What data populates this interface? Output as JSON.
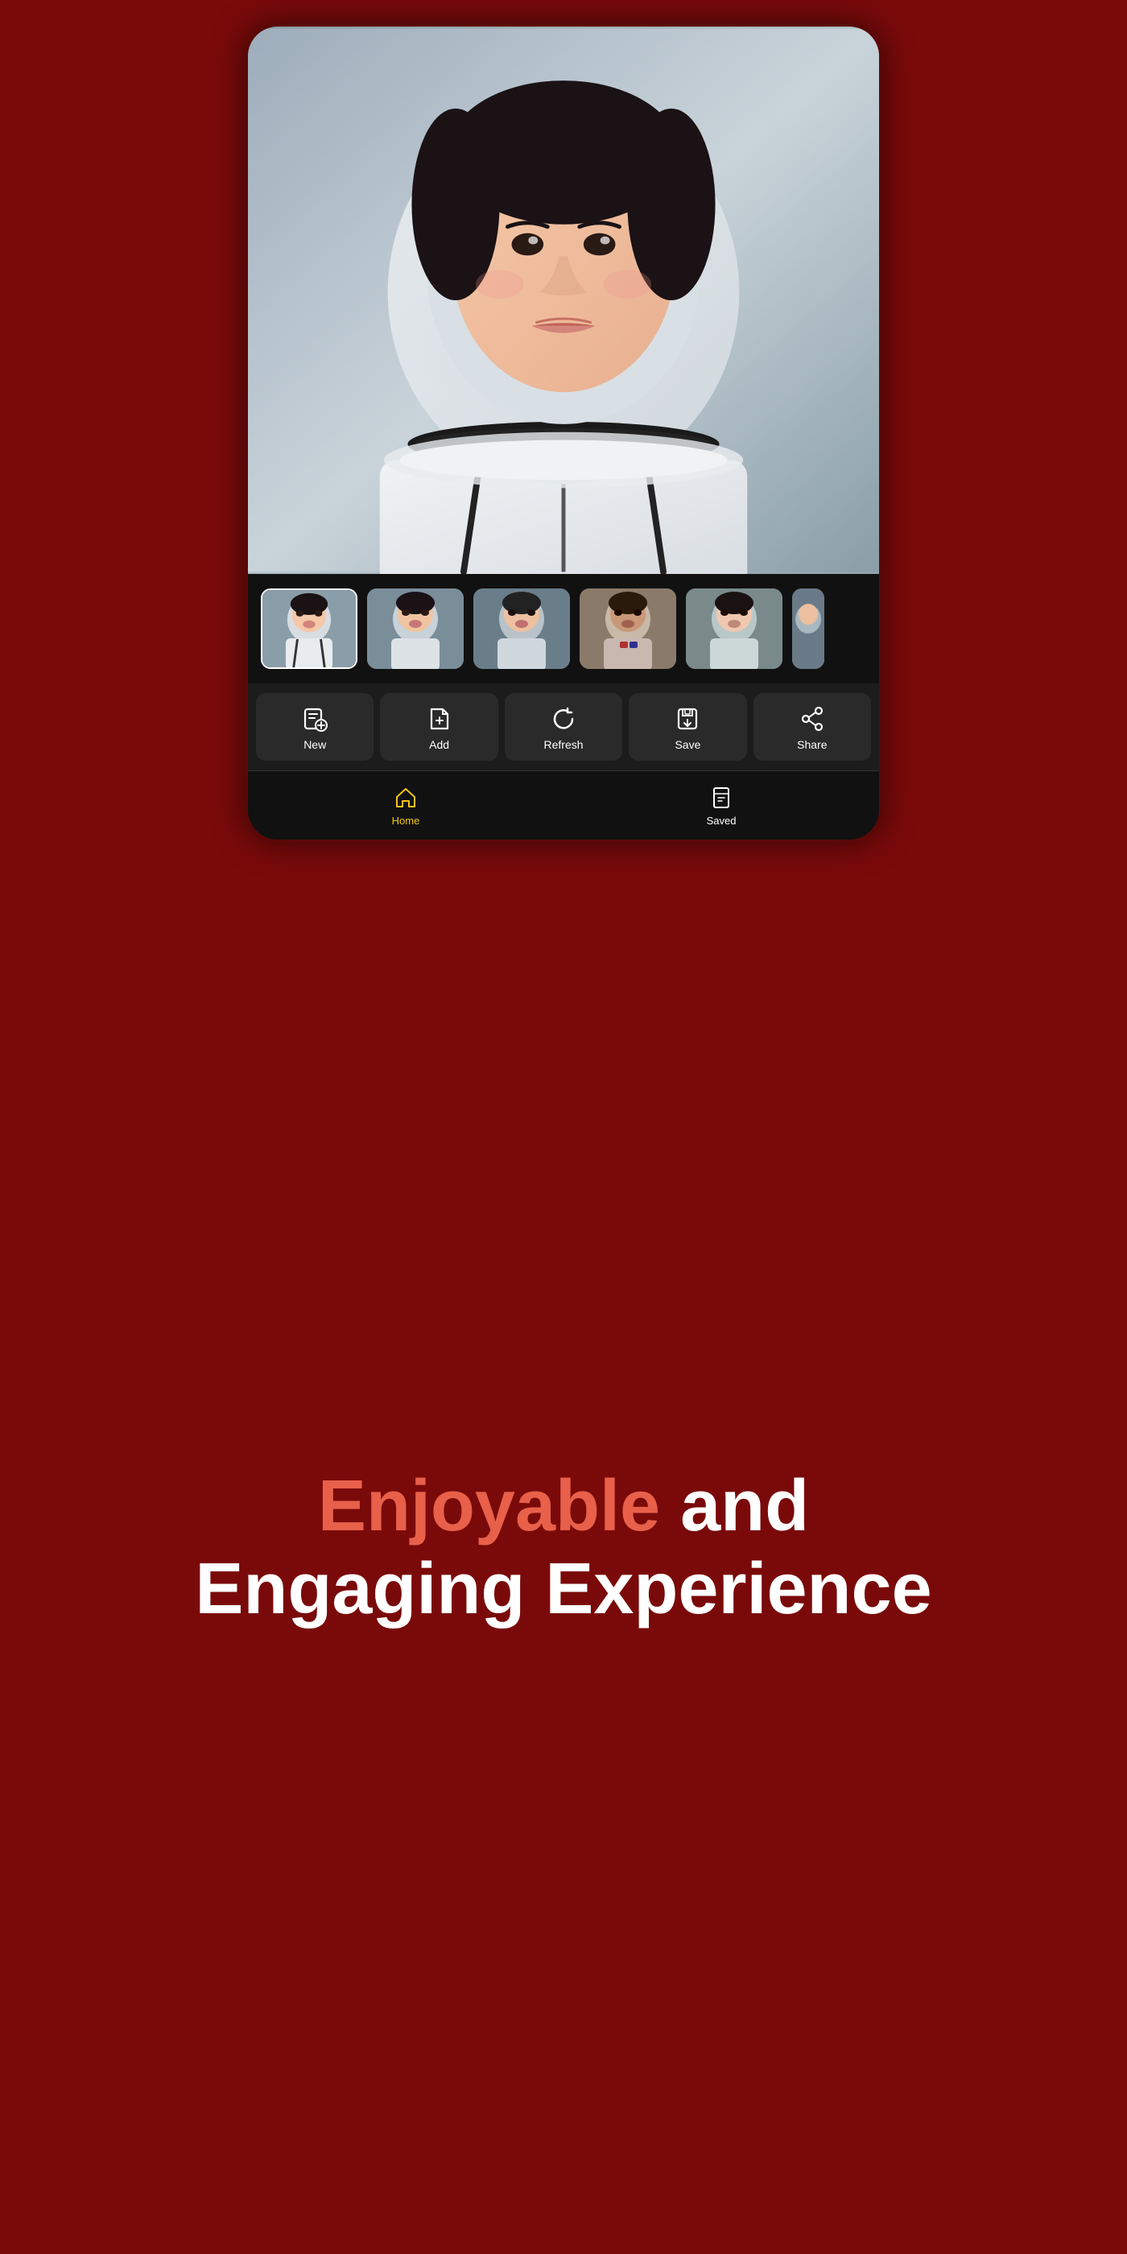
{
  "phone": {
    "toolbar": {
      "buttons": [
        {
          "id": "new",
          "label": "New",
          "icon": "new-folder-icon"
        },
        {
          "id": "add",
          "label": "Add",
          "icon": "add-file-icon"
        },
        {
          "id": "refresh",
          "label": "Refresh",
          "icon": "refresh-icon"
        },
        {
          "id": "save",
          "label": "Save",
          "icon": "save-icon"
        },
        {
          "id": "share",
          "label": "Share",
          "icon": "share-icon"
        }
      ]
    },
    "bottomNav": {
      "items": [
        {
          "id": "home",
          "label": "Home",
          "icon": "home-icon",
          "active": true
        },
        {
          "id": "saved",
          "label": "Saved",
          "icon": "bookmark-icon",
          "active": false
        }
      ]
    }
  },
  "heroText": {
    "line1": "Enjoyable and",
    "line2": "Engaging Experience",
    "highlight": "Enjoyable"
  }
}
